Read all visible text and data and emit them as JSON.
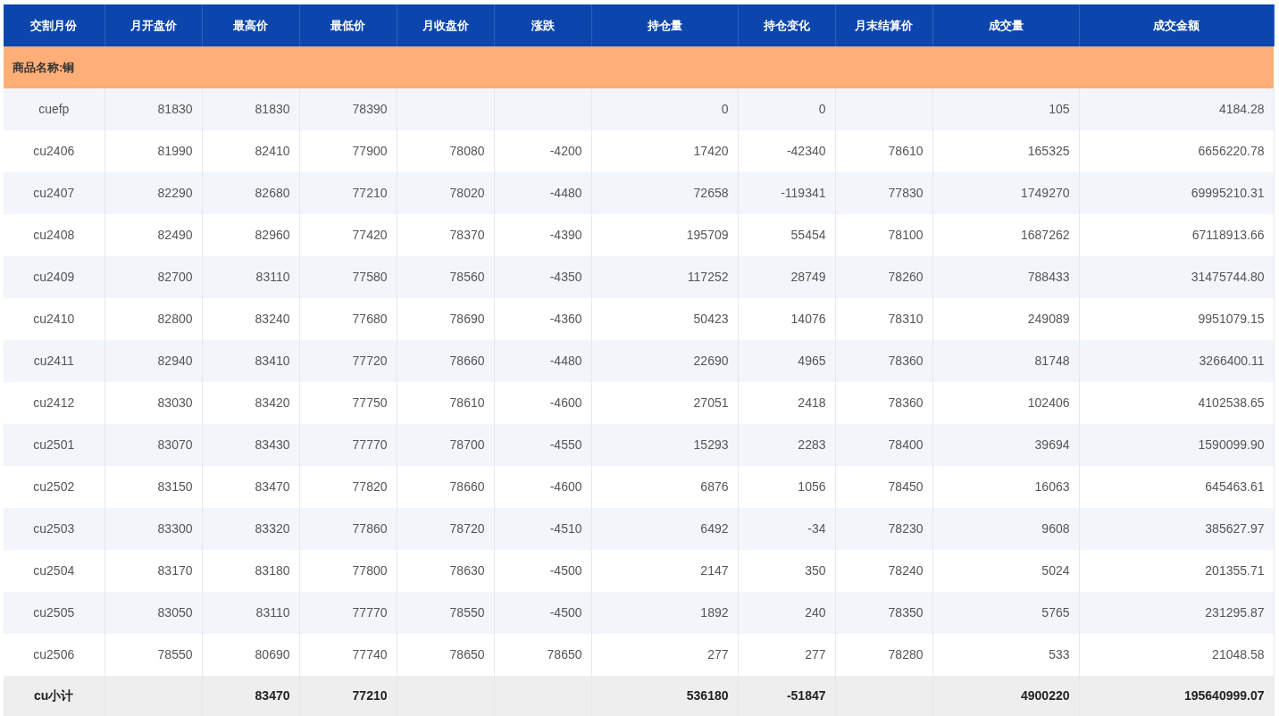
{
  "table": {
    "columns": [
      "交割月份",
      "月开盘价",
      "最高价",
      "最低价",
      "月收盘价",
      "涨跌",
      "持仓量",
      "持仓变化",
      "月末结算价",
      "成交量",
      "成交金额"
    ],
    "group_label": "商品名称:铜",
    "rows": [
      {
        "month": "cuefp",
        "open": "81830",
        "high": "81830",
        "low": "78390",
        "open_interest": "0",
        "oi_change": "0",
        "volume": "105",
        "turnover": "4184.28"
      },
      {
        "month": "cu2406",
        "open": "81990",
        "high": "82410",
        "low": "77900",
        "close": "78080",
        "change": "-4200",
        "open_interest": "17420",
        "oi_change": "-42340",
        "settle": "78610",
        "volume": "165325",
        "turnover": "6656220.78"
      },
      {
        "month": "cu2407",
        "open": "82290",
        "high": "82680",
        "low": "77210",
        "close": "78020",
        "change": "-4480",
        "open_interest": "72658",
        "oi_change": "-119341",
        "settle": "77830",
        "volume": "1749270",
        "turnover": "69995210.31"
      },
      {
        "month": "cu2408",
        "open": "82490",
        "high": "82960",
        "low": "77420",
        "close": "78370",
        "change": "-4390",
        "open_interest": "195709",
        "oi_change": "55454",
        "settle": "78100",
        "volume": "1687262",
        "turnover": "67118913.66"
      },
      {
        "month": "cu2409",
        "open": "82700",
        "high": "83110",
        "low": "77580",
        "close": "78560",
        "change": "-4350",
        "open_interest": "117252",
        "oi_change": "28749",
        "settle": "78260",
        "volume": "788433",
        "turnover": "31475744.80"
      },
      {
        "month": "cu2410",
        "open": "82800",
        "high": "83240",
        "low": "77680",
        "close": "78690",
        "change": "-4360",
        "open_interest": "50423",
        "oi_change": "14076",
        "settle": "78310",
        "volume": "249089",
        "turnover": "9951079.15"
      },
      {
        "month": "cu2411",
        "open": "82940",
        "high": "83410",
        "low": "77720",
        "close": "78660",
        "change": "-4480",
        "open_interest": "22690",
        "oi_change": "4965",
        "settle": "78360",
        "volume": "81748",
        "turnover": "3266400.11"
      },
      {
        "month": "cu2412",
        "open": "83030",
        "high": "83420",
        "low": "77750",
        "close": "78610",
        "change": "-4600",
        "open_interest": "27051",
        "oi_change": "2418",
        "settle": "78360",
        "volume": "102406",
        "turnover": "4102538.65"
      },
      {
        "month": "cu2501",
        "open": "83070",
        "high": "83430",
        "low": "77770",
        "close": "78700",
        "change": "-4550",
        "open_interest": "15293",
        "oi_change": "2283",
        "settle": "78400",
        "volume": "39694",
        "turnover": "1590099.90"
      },
      {
        "month": "cu2502",
        "open": "83150",
        "high": "83470",
        "low": "77820",
        "close": "78660",
        "change": "-4600",
        "open_interest": "6876",
        "oi_change": "1056",
        "settle": "78450",
        "volume": "16063",
        "turnover": "645463.61"
      },
      {
        "month": "cu2503",
        "open": "83300",
        "high": "83320",
        "low": "77860",
        "close": "78720",
        "change": "-4510",
        "open_interest": "6492",
        "oi_change": "-34",
        "settle": "78230",
        "volume": "9608",
        "turnover": "385627.97"
      },
      {
        "month": "cu2504",
        "open": "83170",
        "high": "83180",
        "low": "77800",
        "close": "78630",
        "change": "-4500",
        "open_interest": "2147",
        "oi_change": "350",
        "settle": "78240",
        "volume": "5024",
        "turnover": "201355.71"
      },
      {
        "month": "cu2505",
        "open": "83050",
        "high": "83110",
        "low": "77770",
        "close": "78550",
        "change": "-4500",
        "open_interest": "1892",
        "oi_change": "240",
        "settle": "78350",
        "volume": "5765",
        "turnover": "231295.87"
      },
      {
        "month": "cu2506",
        "open": "78550",
        "high": "80690",
        "low": "77740",
        "close": "78650",
        "change": "78650",
        "open_interest": "277",
        "oi_change": "277",
        "settle": "78280",
        "volume": "533",
        "turnover": "21048.58"
      }
    ],
    "subtotal": {
      "month": "cu小计",
      "high": "83470",
      "low": "77210",
      "open_interest": "536180",
      "oi_change": "-51847",
      "volume": "4900220",
      "turnover": "195640999.07"
    }
  }
}
